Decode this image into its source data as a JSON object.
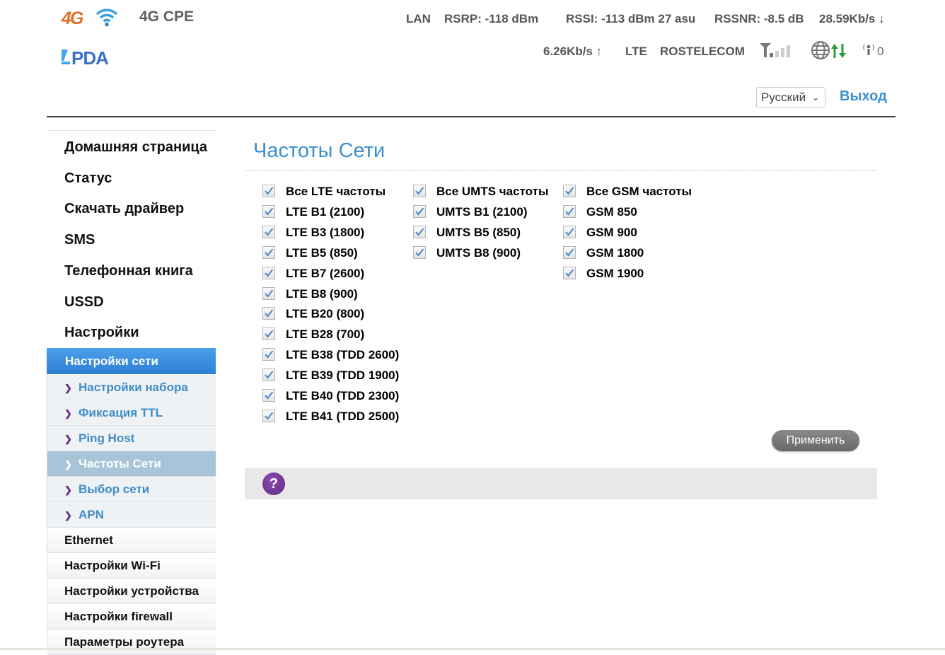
{
  "header": {
    "logo_4g": "4G",
    "product_name": "4G CPE",
    "brand_logo": "4PDA",
    "status": {
      "connection": "LAN",
      "rsrp": "RSRP: -118 dBm",
      "rssi": "RSSI: -113 dBm 27 asu",
      "rssnr": "RSSNR: -8.5 dB",
      "download_speed": "28.59Kb/s ↓",
      "upload_speed": "6.26Kb/s ↑",
      "network_type": "LTE",
      "operator": "ROSTELECOM",
      "signal_bars": 2,
      "signal_bars_total": 5,
      "wifi_clients": "0"
    },
    "language": "Русский",
    "logout_label": "Выход"
  },
  "sidebar": {
    "main_items": [
      {
        "label": "Домашняя страница"
      },
      {
        "label": "Статус"
      },
      {
        "label": "Скачать драйвер"
      },
      {
        "label": "SMS"
      },
      {
        "label": "Телефонная книга"
      },
      {
        "label": "USSD"
      },
      {
        "label": "Настройки"
      }
    ],
    "section_header": "Настройки сети",
    "sub_items": [
      {
        "label": "Настройки набора",
        "active": false
      },
      {
        "label": "Фиксация TTL",
        "active": false
      },
      {
        "label": "Ping Host",
        "active": false
      },
      {
        "label": "Частоты Сети",
        "active": true
      },
      {
        "label": "Выбор сети",
        "active": false
      },
      {
        "label": "APN",
        "active": false
      }
    ],
    "other_items": [
      {
        "label": "Ethernet"
      },
      {
        "label": "Настройки Wi-Fi"
      },
      {
        "label": "Настройки устройства"
      },
      {
        "label": "Настройки firewall"
      },
      {
        "label": "Параметры роутера"
      }
    ]
  },
  "main": {
    "title": "Частоты Сети",
    "lte": [
      {
        "label": "Все LTE частоты",
        "checked": true
      },
      {
        "label": "LTE B1 (2100)",
        "checked": true
      },
      {
        "label": "LTE B3 (1800)",
        "checked": true
      },
      {
        "label": "LTE B5 (850)",
        "checked": true
      },
      {
        "label": "LTE B7 (2600)",
        "checked": true
      },
      {
        "label": "LTE B8 (900)",
        "checked": true
      },
      {
        "label": "LTE B20 (800)",
        "checked": true
      },
      {
        "label": "LTE B28 (700)",
        "checked": true
      },
      {
        "label": "LTE B38 (TDD 2600)",
        "checked": true
      },
      {
        "label": "LTE B39 (TDD 1900)",
        "checked": true
      },
      {
        "label": "LTE B40 (TDD 2300)",
        "checked": true
      },
      {
        "label": "LTE B41 (TDD 2500)",
        "checked": true
      }
    ],
    "umts": [
      {
        "label": "Все UMTS частоты",
        "checked": true
      },
      {
        "label": "UMTS B1 (2100)",
        "checked": true
      },
      {
        "label": "UMTS B5 (850)",
        "checked": true
      },
      {
        "label": "UMTS B8 (900)",
        "checked": true
      }
    ],
    "gsm": [
      {
        "label": "Все GSM частоты",
        "checked": true
      },
      {
        "label": "GSM 850",
        "checked": true
      },
      {
        "label": "GSM 900",
        "checked": true
      },
      {
        "label": "GSM 1800",
        "checked": true
      },
      {
        "label": "GSM 1900",
        "checked": true
      }
    ],
    "apply_label": "Применить",
    "help_symbol": "?"
  }
}
